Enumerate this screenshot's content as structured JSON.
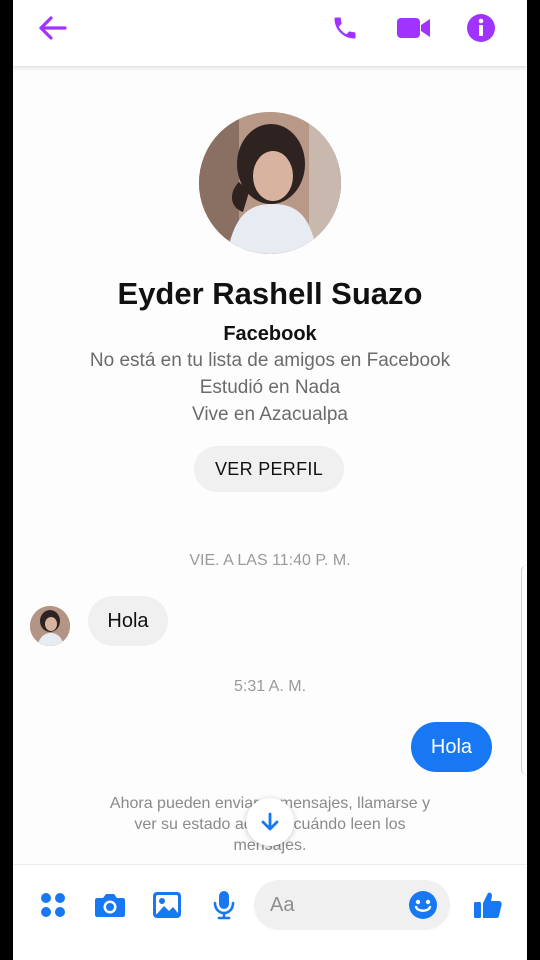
{
  "colors": {
    "accent": "#a033ff",
    "messenger_blue": "#1877f2"
  },
  "header": {
    "icons": [
      "arrow-left-icon",
      "phone-icon",
      "video-camera-icon",
      "info-icon"
    ]
  },
  "profile": {
    "name": "Eyder Rashell Suazo",
    "source": "Facebook",
    "line1": "No está en tu lista de amigos en Facebook",
    "line2": "Estudió en Nada",
    "line3": "Vive en Azacualpa",
    "view_profile_label": "VER PERFIL"
  },
  "conversation": {
    "timestamp1": "VIE. A LAS 11:40 P. M.",
    "incoming_text": "Hola",
    "timestamp2": "5:31 A. M.",
    "outgoing_text": "Hola",
    "note_line1": "Ahora pueden enviarse mensajes, llamarse y",
    "note_line2": "ver su estado activo y cuándo leen los",
    "note_line3": "mensajes."
  },
  "composer": {
    "placeholder": "Aa",
    "icons": [
      "four-dots-icon",
      "camera-icon",
      "image-icon",
      "microphone-icon",
      "emoji-icon",
      "thumbs-up-icon"
    ]
  }
}
